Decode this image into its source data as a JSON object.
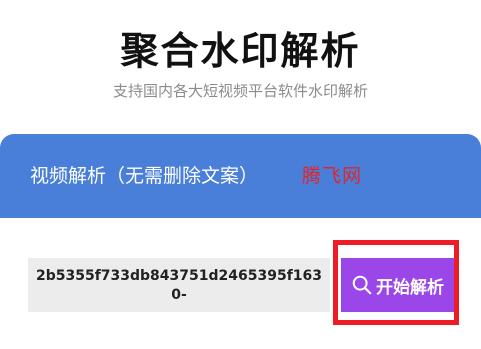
{
  "header": {
    "title": "聚合水印解析",
    "subtitle": "支持国内各大短视频平台软件水印解析"
  },
  "banner": {
    "title": "视频解析（无需删除文案）",
    "watermark": "腾飞网"
  },
  "search": {
    "input_value": "2b5355f733db843751d2465395f1630-",
    "button_label": "开始解析",
    "button_icon": "search-icon"
  },
  "colors": {
    "banner": "#4a7fd9",
    "button": "#9a46e8",
    "highlight": "#ee1c25",
    "input_bg": "#ececec"
  }
}
